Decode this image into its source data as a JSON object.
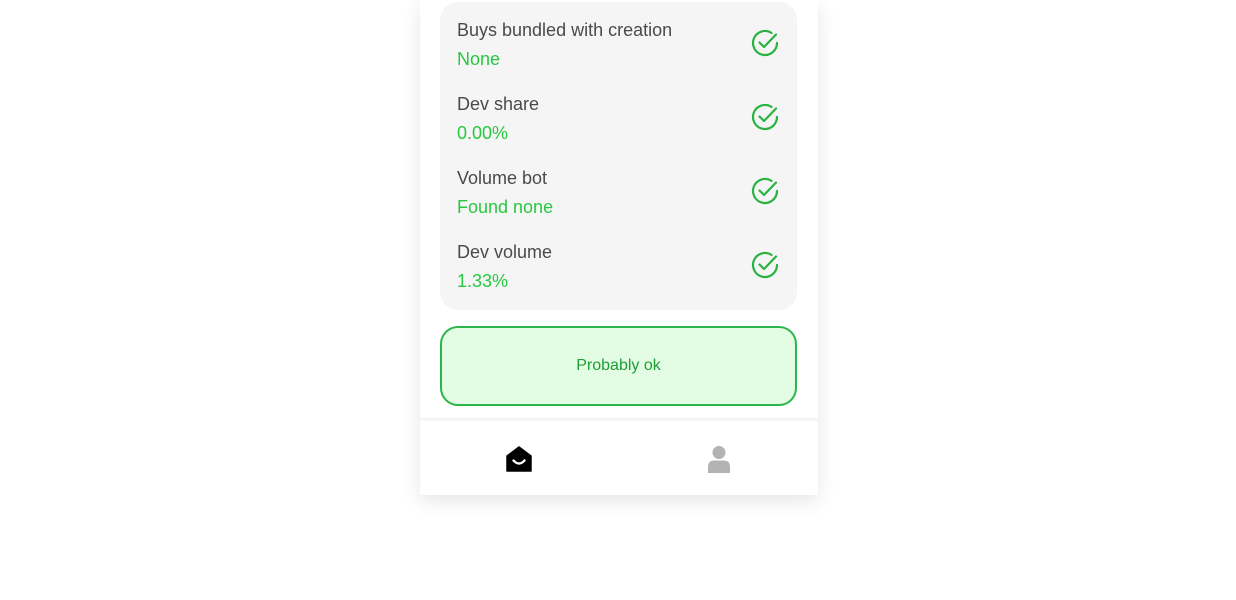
{
  "checks": [
    {
      "label": "Buys bundled with creation",
      "value": "None",
      "icon": "check-circle-icon"
    },
    {
      "label": "Dev share",
      "value": "0.00%",
      "icon": "check-circle-icon"
    },
    {
      "label": "Volume bot",
      "value": "Found none",
      "icon": "check-circle-icon"
    },
    {
      "label": "Dev volume",
      "value": "1.33%",
      "icon": "check-circle-icon"
    }
  ],
  "verdict": {
    "text": "Probably ok",
    "border_color": "#2bb54a",
    "background_color": "#e2fde3"
  },
  "tabbar": {
    "items": [
      {
        "icon": "home-icon",
        "active": true
      },
      {
        "icon": "user-icon",
        "active": false
      }
    ]
  },
  "colors": {
    "accent_green": "#28c840",
    "label_gray": "#4a4a4a",
    "card_background": "#f5f5f5"
  }
}
